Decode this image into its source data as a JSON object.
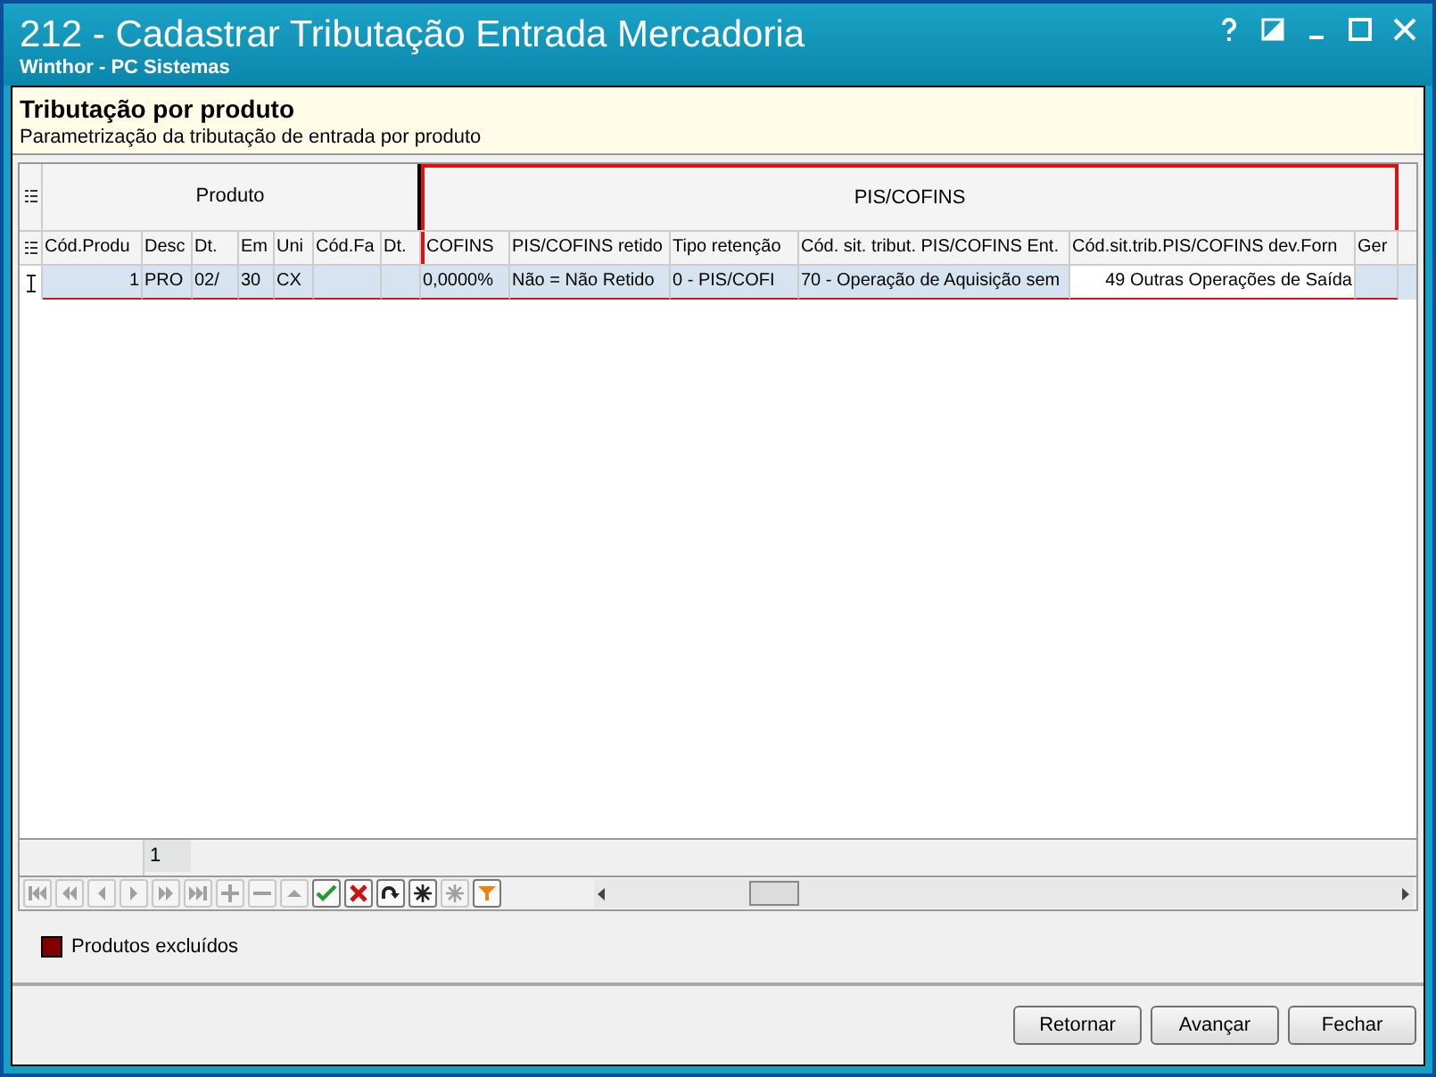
{
  "window": {
    "title": "212 - Cadastrar Tributação Entrada Mercadoria",
    "subtitle": "Winthor - PC Sistemas"
  },
  "header": {
    "title": "Tributação por produto",
    "description": "Parametrização da tributação de entrada por produto"
  },
  "grid": {
    "groups": [
      {
        "label": "Produto",
        "highlighted": false,
        "columns": [
          "Cód.Produ",
          "Desc",
          "Dt.",
          "Em",
          "Uni",
          "Cód.Fa",
          "Dt."
        ]
      },
      {
        "label": "PIS/COFINS",
        "highlighted": true,
        "columns": [
          "COFINS",
          "PIS/COFINS retido",
          "Tipo retenção",
          "Cód. sit. tribut. PIS/COFINS Ent.",
          "Cód.sit.trib.PIS/COFINS dev.Forn",
          "Ger"
        ]
      }
    ],
    "rows": [
      {
        "selected": true,
        "cells": [
          "1",
          "PRO",
          "02/",
          "30",
          "CX",
          "",
          "",
          "0,0000%",
          "Não = Não Retido",
          "0 - PIS/COFI",
          "70 - Operação de Aquisição sem",
          "49 Outras Operações de Saída",
          ""
        ]
      }
    ],
    "footer_count": "1"
  },
  "navigator": [
    {
      "kind": "first",
      "disabled": true
    },
    {
      "kind": "prior-page",
      "disabled": true
    },
    {
      "kind": "prior",
      "disabled": true
    },
    {
      "kind": "next",
      "disabled": true
    },
    {
      "kind": "next-page",
      "disabled": true
    },
    {
      "kind": "last",
      "disabled": true
    },
    {
      "kind": "insert",
      "disabled": true
    },
    {
      "kind": "delete",
      "disabled": true
    },
    {
      "kind": "edit",
      "disabled": true
    },
    {
      "kind": "post",
      "disabled": false
    },
    {
      "kind": "cancel",
      "disabled": false
    },
    {
      "kind": "refresh",
      "disabled": false
    },
    {
      "kind": "bookmark",
      "disabled": false
    },
    {
      "kind": "goto-bookmark",
      "disabled": true
    },
    {
      "kind": "filter",
      "disabled": false
    }
  ],
  "legend": [
    {
      "label": "Produtos excluídos",
      "color": "#800000"
    }
  ],
  "buttons": [
    "Retornar",
    "Avançar",
    "Fechar"
  ]
}
